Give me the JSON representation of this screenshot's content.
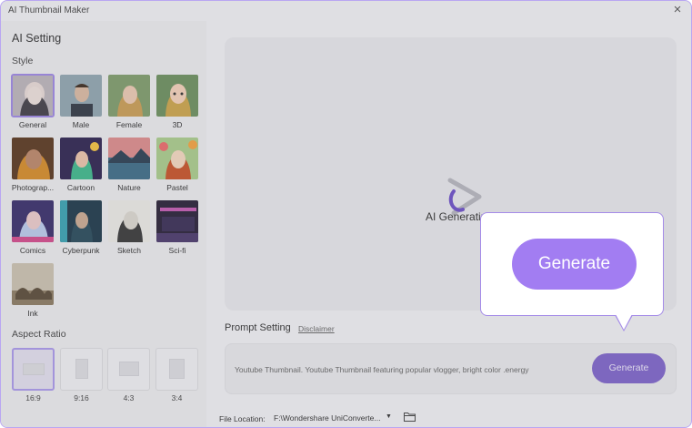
{
  "window": {
    "title": "AI Thumbnail Maker"
  },
  "sidebar": {
    "heading": "AI Setting",
    "style_label": "Style",
    "styles": [
      {
        "name": "General"
      },
      {
        "name": "Male"
      },
      {
        "name": "Female"
      },
      {
        "name": "3D"
      },
      {
        "name": "Photograp..."
      },
      {
        "name": "Cartoon"
      },
      {
        "name": "Nature"
      },
      {
        "name": "Pastel"
      },
      {
        "name": "Comics"
      },
      {
        "name": "Cyberpunk"
      },
      {
        "name": "Sketch"
      },
      {
        "name": "Sci-fi"
      },
      {
        "name": "Ink"
      }
    ],
    "aspect_label": "Aspect Ratio",
    "ratios": [
      {
        "label": "16:9"
      },
      {
        "label": "9:16"
      },
      {
        "label": "4:3"
      },
      {
        "label": "3:4"
      }
    ]
  },
  "preview": {
    "status": "AI Generating ..."
  },
  "prompt": {
    "label": "Prompt Setting",
    "disclaimer": "Disclaimer",
    "text": "Youtube Thumbnail. Youtube Thumbnail featuring popular vlogger, bright color .energy",
    "generate_label": "Generate"
  },
  "file": {
    "label": "File Location:",
    "path": "F:\\Wondershare UniConverte..."
  },
  "callout": {
    "generate_label": "Generate"
  },
  "colors": {
    "accent": "#a27df2",
    "button_dark": "#7d63c6",
    "border": "#a48be8"
  }
}
